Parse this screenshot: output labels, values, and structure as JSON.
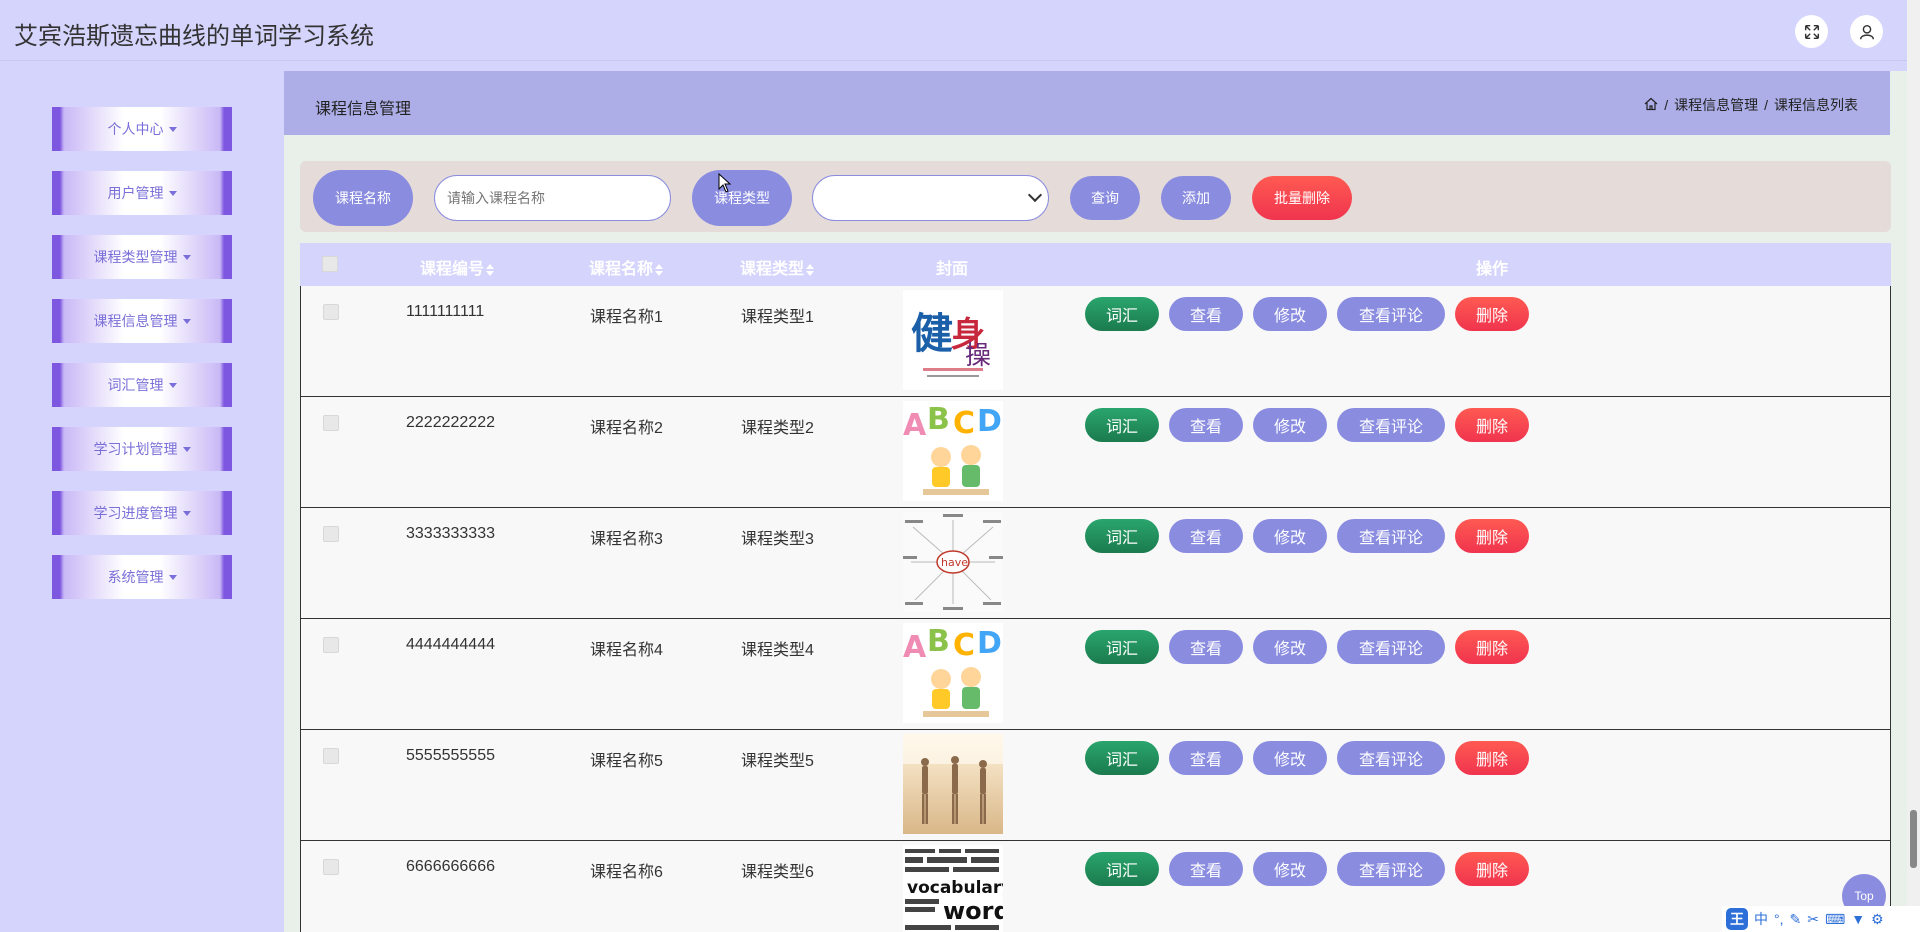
{
  "app": {
    "title": "艾宾浩斯遗忘曲线的单词学习系统"
  },
  "header_icons": {
    "fullscreen": "fullscreen-icon",
    "user": "user-icon"
  },
  "sidebar": {
    "items": [
      {
        "label": "个人中心"
      },
      {
        "label": "用户管理"
      },
      {
        "label": "课程类型管理"
      },
      {
        "label": "课程信息管理"
      },
      {
        "label": "词汇管理"
      },
      {
        "label": "学习计划管理"
      },
      {
        "label": "学习进度管理"
      },
      {
        "label": "系统管理"
      }
    ]
  },
  "breadcrumb": {
    "title": "课程信息管理",
    "path": [
      "课程信息管理",
      "课程信息列表"
    ],
    "separator": "/"
  },
  "search": {
    "name_label": "课程名称",
    "name_placeholder": "请输入课程名称",
    "type_label": "课程类型",
    "type_selected": "",
    "query_button": "查询",
    "add_button": "添加",
    "batch_delete_button": "批量删除"
  },
  "table": {
    "headers": {
      "code": "课程编号",
      "name": "课程名称",
      "type": "课程类型",
      "cover": "封面",
      "actions": "操作"
    },
    "action_labels": {
      "vocab": "词汇",
      "view": "查看",
      "edit": "修改",
      "comments": "查看评论",
      "delete": "删除"
    },
    "rows": [
      {
        "code": "1111111111",
        "name": "课程名称1",
        "type": "课程类型1",
        "cover": "fitness-poster"
      },
      {
        "code": "2222222222",
        "name": "课程名称2",
        "type": "课程类型2",
        "cover": "abcd-kids"
      },
      {
        "code": "3333333333",
        "name": "课程名称3",
        "type": "课程类型3",
        "cover": "have-mindmap"
      },
      {
        "code": "4444444444",
        "name": "课程名称4",
        "type": "课程类型4",
        "cover": "abcd-kids"
      },
      {
        "code": "5555555555",
        "name": "课程名称5",
        "type": "课程类型5",
        "cover": "dancers"
      },
      {
        "code": "6666666666",
        "name": "课程名称6",
        "type": "课程类型6",
        "cover": "vocabulary-words"
      }
    ]
  },
  "top_button": {
    "label": "Top"
  },
  "ime": {
    "logo": "王",
    "mode": "中"
  },
  "colors": {
    "accent": "#8a8ce0",
    "success": "#1f8a57",
    "danger": "#f53d4f",
    "sidebar_bg": "#d4d4fc"
  }
}
